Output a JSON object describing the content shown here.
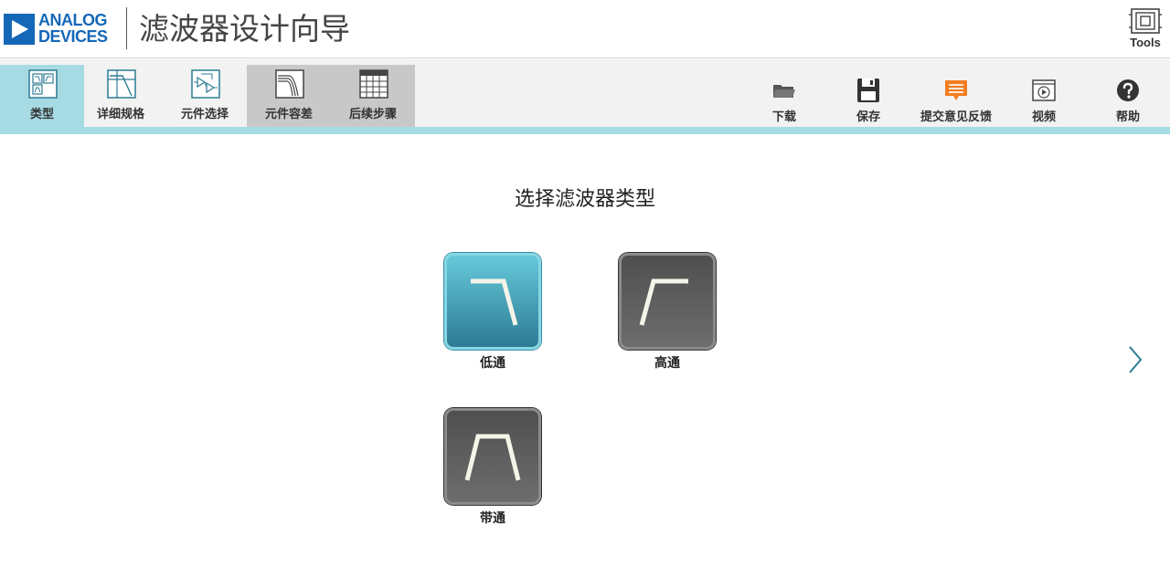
{
  "header": {
    "logo_line1": "ANALOG",
    "logo_line2": "DEVICES",
    "title": "滤波器设计向导",
    "tools_label": "Tools"
  },
  "tabs": [
    {
      "label": "类型",
      "icon": "filter-type-icon",
      "state": "active"
    },
    {
      "label": "详细规格",
      "icon": "specifications-icon",
      "state": "enabled"
    },
    {
      "label": "元件选择",
      "icon": "component-selection-icon",
      "state": "enabled"
    },
    {
      "label": "元件容差",
      "icon": "tolerances-icon",
      "state": "disabled"
    },
    {
      "label": "后续步骤",
      "icon": "next-steps-icon",
      "state": "disabled"
    }
  ],
  "actions": [
    {
      "label": "下载",
      "icon": "folder-icon"
    },
    {
      "label": "保存",
      "icon": "save-icon"
    },
    {
      "label": "提交意见反馈",
      "icon": "feedback-icon"
    },
    {
      "label": "视频",
      "icon": "video-icon"
    },
    {
      "label": "帮助",
      "icon": "help-icon"
    }
  ],
  "main": {
    "title": "选择滤波器类型",
    "filters": [
      {
        "label": "低通",
        "icon": "lowpass-icon",
        "selected": true
      },
      {
        "label": "高通",
        "icon": "highpass-icon",
        "selected": false
      },
      {
        "label": "带通",
        "icon": "bandpass-icon",
        "selected": false
      }
    ],
    "next_icon": "chevron-right-icon"
  },
  "colors": {
    "accent": "#a6dbe4",
    "brand": "#1568b8",
    "selected_tile": "#2c7b94",
    "feedback": "#f47d20"
  }
}
